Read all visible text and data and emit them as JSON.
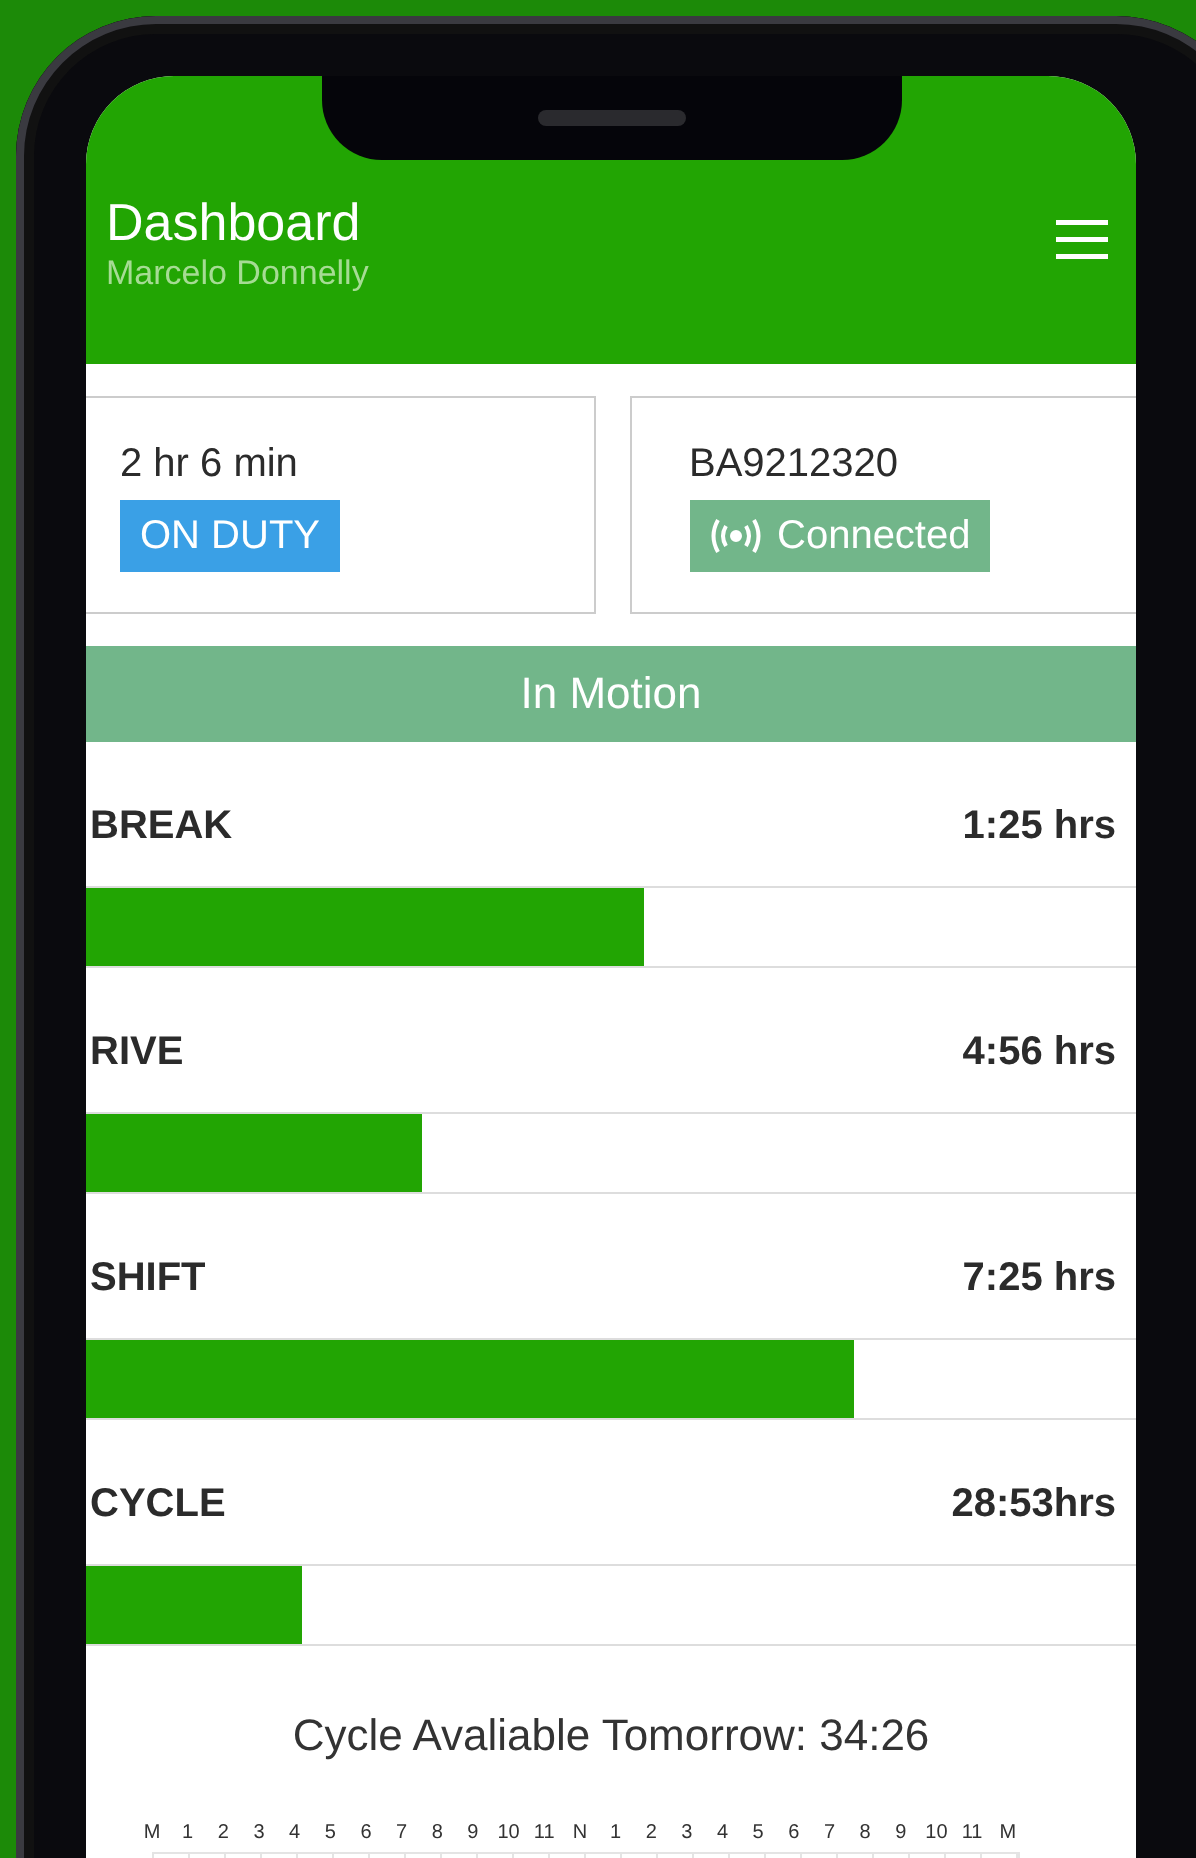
{
  "header": {
    "title": "Dashboard",
    "subtitle": "Marcelo Donnelly"
  },
  "status_cards": [
    {
      "kind": "duty",
      "value": "2 hr 6 min",
      "badge": "ON DUTY"
    },
    {
      "kind": "device",
      "value": "BA9212320",
      "badge": "Connected"
    }
  ],
  "motion_banner": "In Motion",
  "timers": [
    {
      "label": "BREAK",
      "reading": "1:25 hrs",
      "level": 0.53
    },
    {
      "label": "RIVE",
      "reading": "4:56 hrs",
      "level": 0.33
    },
    {
      "label": "SHIFT",
      "reading": "7:25 hrs",
      "level": 0.72
    },
    {
      "label": "CYCLE",
      "reading": "28:53hrs",
      "level": 0.22
    }
  ],
  "cycle_tomorrow": "Cycle Avaliable Tomorrow: 34:26",
  "log_grid": {
    "hours": [
      "M",
      "1",
      "2",
      "3",
      "4",
      "5",
      "6",
      "7",
      "8",
      "9",
      "10",
      "11",
      "N",
      "1",
      "2",
      "3",
      "4",
      "5",
      "6",
      "7",
      "8",
      "9",
      "10",
      "11",
      "M"
    ]
  }
}
